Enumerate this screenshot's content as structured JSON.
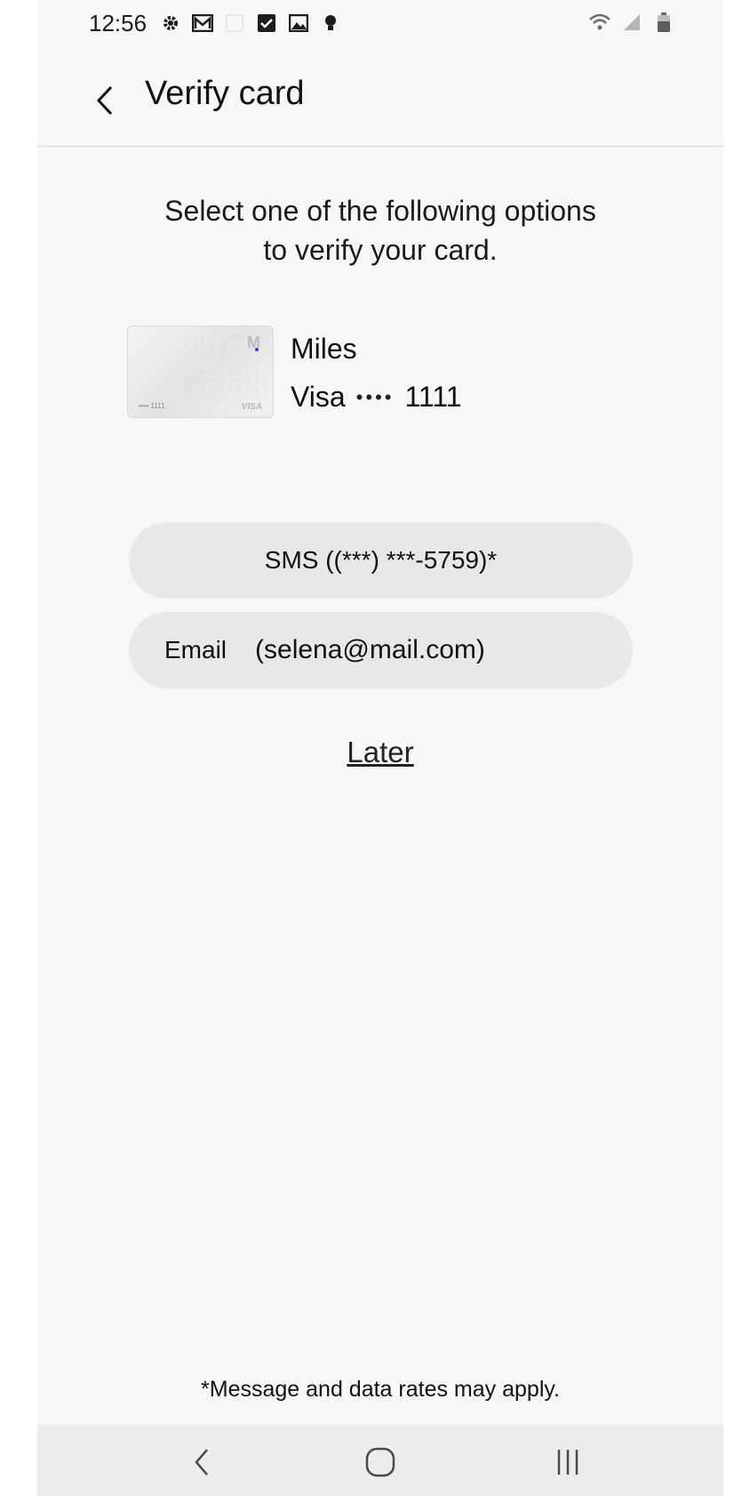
{
  "status_bar": {
    "time": "12:56"
  },
  "header": {
    "title": "Verify card"
  },
  "instructions": {
    "line1": "Select one of the following options",
    "line2": "to verify your card."
  },
  "card": {
    "name": "Miles",
    "network": "Visa",
    "masked_dots": "••••",
    "last4": "1111",
    "thumb_number": "•••• 1111",
    "thumb_brand": "VISA",
    "thumb_logo": "M"
  },
  "options": {
    "sms_label": "SMS ((***) ***-5759)*",
    "email_label": "Email",
    "email_value": "(selena@mail.com)"
  },
  "later_label": "Later",
  "disclaimer": "*Message and data rates may apply.",
  "icons": {
    "status": [
      "gear-icon",
      "mail-icon",
      "checkbox-icon",
      "image-icon",
      "bulb-icon",
      "wifi-icon",
      "signal-icon",
      "battery-icon"
    ],
    "nav": [
      "nav-back-icon",
      "nav-home-icon",
      "nav-recent-icon"
    ]
  },
  "colors": {
    "background": "#f7f7f7",
    "button": "#e8e8e8",
    "text": "#111111",
    "card_accent": "#3a3ad0"
  }
}
